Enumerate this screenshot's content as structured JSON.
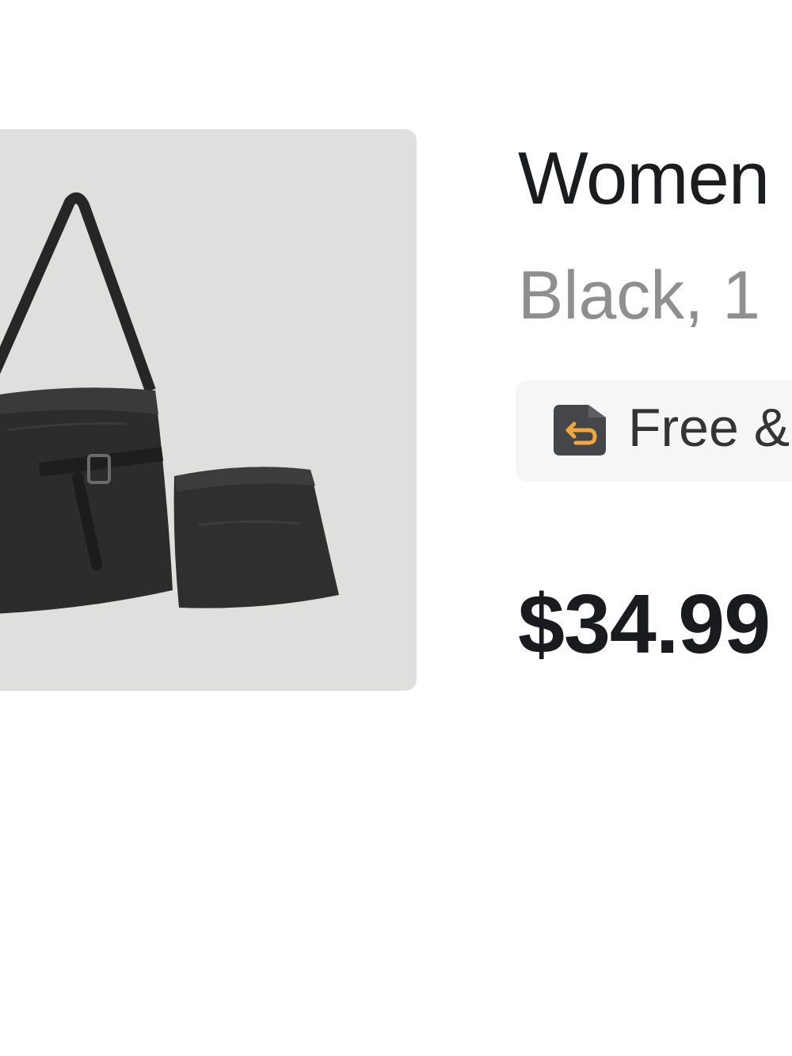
{
  "product": {
    "title": "Women",
    "variant": "Black, 1",
    "badge": {
      "icon": "return-box-icon",
      "text": "Free &"
    },
    "price": "$34.99",
    "image": {
      "icon": "handbag-set-image",
      "background": "#dfdfdd"
    }
  },
  "colors": {
    "text_primary": "#1b1c1e",
    "text_secondary": "#8f8f8f",
    "badge_bg": "#f6f6f6",
    "badge_icon_bg": "#45464a",
    "badge_icon_arrow": "#f2a640"
  }
}
